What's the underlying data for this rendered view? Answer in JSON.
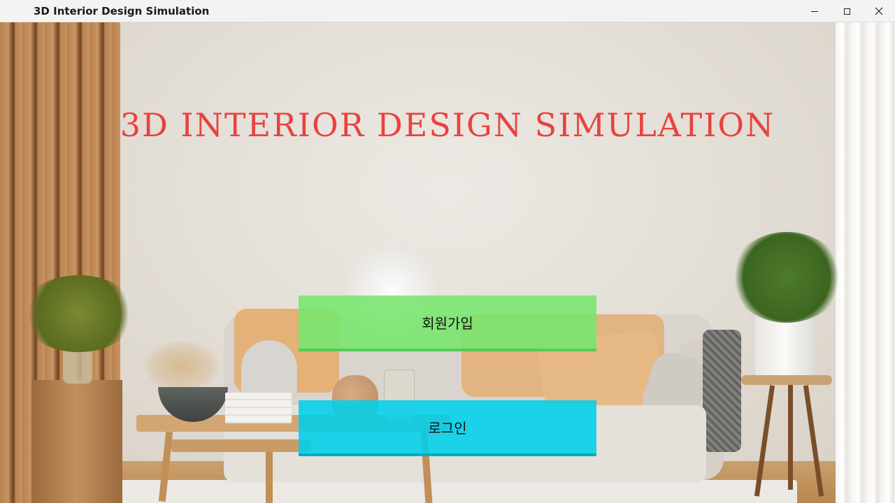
{
  "window": {
    "title": "3D Interior Design Simulation",
    "controls": [
      "minimize-icon",
      "maximize-icon",
      "close-icon"
    ]
  },
  "main": {
    "heading": "3D INTERIOR DESIGN SIMULATION",
    "signup_label": "회원가입",
    "login_label": "로그인"
  },
  "colors": {
    "heading": "#e9423f",
    "signup_button": "#76e66d",
    "login_button": "#00cfea"
  }
}
